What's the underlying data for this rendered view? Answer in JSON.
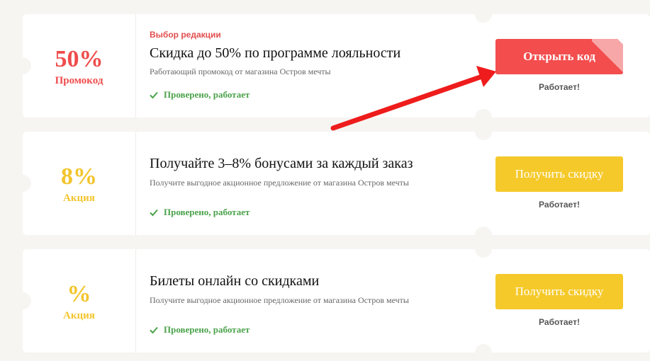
{
  "coupons": [
    {
      "value": "50%",
      "type": "Промокод",
      "label": "Выбор редакции",
      "title": "Скидка до 50% по программе лояльности",
      "description": "Работающий промокод от магазина Остров мечты",
      "verified": "Проверено, работает",
      "button": "Открыть код",
      "status": "Работает!",
      "accent": "#ef4c4c"
    },
    {
      "value": "8%",
      "type": "Акция",
      "title": "Получайте 3–8% бонусами за каждый заказ",
      "description": "Получите выгодное акционное предложение от магазина Остров мечты",
      "verified": "Проверено, работает",
      "button": "Получить скидку",
      "status": "Работает!",
      "accent": "#f3c52d"
    },
    {
      "value": "%",
      "type": "Акция",
      "title": "Билеты онлайн со скидками",
      "description": "Получите выгодное акционное предложение от магазина Остров мечты",
      "verified": "Проверено, работает",
      "button": "Получить скидку",
      "status": "Работает!",
      "accent": "#f3c52d"
    }
  ],
  "icons": {
    "verified": "check-icon",
    "pointer": "red-arrow-icon"
  },
  "colors": {
    "red": "#f34d4d",
    "yellow": "#f5c92a",
    "green": "#4aa24a",
    "background": "#f6f5f2"
  }
}
